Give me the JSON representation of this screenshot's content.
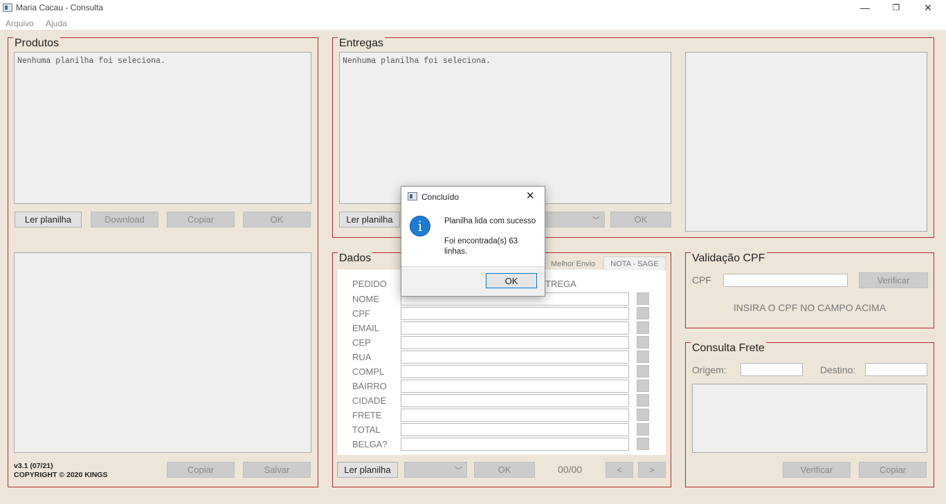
{
  "window": {
    "title": "Maria Cacau - Consulta",
    "minimize": "—",
    "restore": "❐",
    "close": "✕"
  },
  "menu": [
    "Arquivo",
    "Ajuda"
  ],
  "produtos": {
    "title": "Produtos",
    "status": "Nenhuma planilha foi seleciona.",
    "buttons": {
      "ler": "Ler planilha",
      "download": "Download",
      "copiar": "Copiar",
      "ok": "OK"
    },
    "version": "v3.1 (07/21)",
    "copyright": "COPYRIGHT © 2020 KINGS",
    "bottom_buttons": {
      "copiar": "Copiar",
      "salvar": "Salvar"
    }
  },
  "entregas": {
    "title": "Entregas",
    "status": "Nenhuma planilha foi seleciona.",
    "buttons": {
      "ler": "Ler planilha",
      "ok": "OK"
    }
  },
  "dados": {
    "title": "Dados",
    "tabs": [
      {
        "label": "Melhor Envio",
        "selected": false
      },
      {
        "label": "NOTA - SAGE",
        "selected": true
      }
    ],
    "pedido_label": "PEDIDO",
    "entrega_partial": "TREGA",
    "fields": [
      "NOME",
      "CPF",
      "EMAIL",
      "CEP",
      "RUA",
      "COMPL",
      "BAIRRO",
      "CIDADE",
      "FRETE",
      "TOTAL",
      "BELGA?"
    ],
    "buttons": {
      "ler": "Ler planilha",
      "ok": "OK",
      "prev": "<",
      "next": ">"
    },
    "counter": "00/00"
  },
  "validacao": {
    "title": "Validação CPF",
    "cpf_label": "CPF",
    "verificar": "Verificar",
    "message": "INSIRA O CPF NO CAMPO ACIMA"
  },
  "frete": {
    "title": "Consulta Frete",
    "origem": "Origem:",
    "destino": "Destino:",
    "verificar": "Verificar",
    "copiar": "Copiar"
  },
  "dialog": {
    "title": "Concluído",
    "close": "✕",
    "line1": "Planilha lida com sucesso",
    "line2": "Foi encontrada(s) 63 linhas.",
    "icon": "i",
    "ok": "OK"
  },
  "colors": {
    "background": "#ede6d8",
    "group_border": "#b3292e",
    "dialog_accent": "#0078d7",
    "info_icon": "#1f7ad1"
  }
}
